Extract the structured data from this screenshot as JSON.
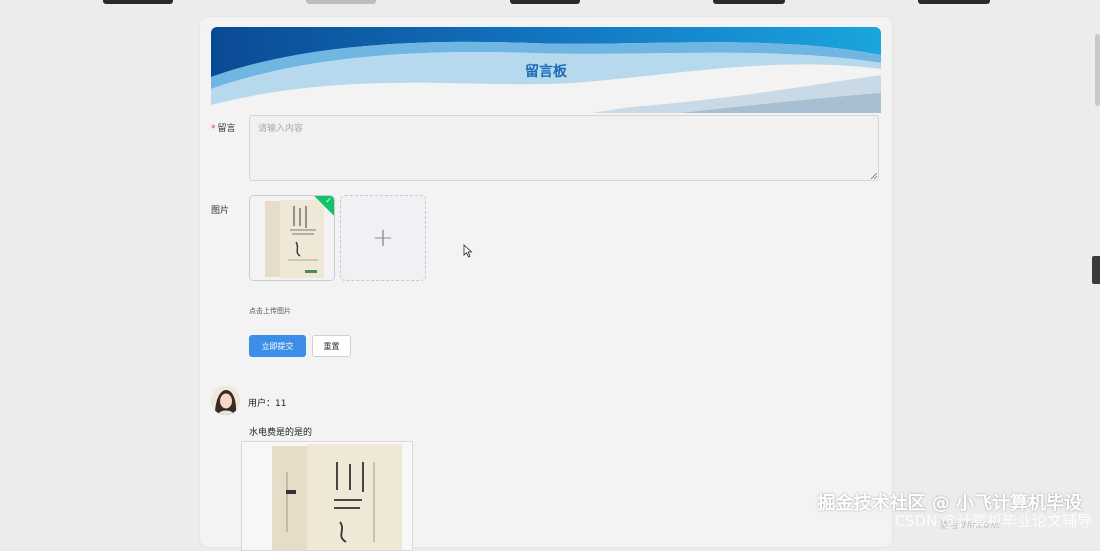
{
  "banner": {
    "title": "留言板"
  },
  "form": {
    "message_label": "留言",
    "message_required_mark": "*",
    "message_placeholder": "请输入内容",
    "image_label": "图片",
    "upload_hint": "点击上传图片",
    "submit_label": "立即提交",
    "reset_label": "重置",
    "upload_plus": "+"
  },
  "comments": [
    {
      "user_label": "用户：11",
      "text": "水电费是的是的"
    }
  ],
  "watermark": {
    "line1": "掘金技术社区 @ 小飞计算机毕设",
    "line2": "CSDN @计算机毕业论文辅导"
  },
  "system": {
    "activate_windows": "激活 Windows"
  },
  "colors": {
    "primary": "#3d8ee8",
    "banner_title": "#1b6cb5",
    "upload_success": "#13c16b",
    "required": "#e53935"
  },
  "icons": {
    "upload": "plus-icon",
    "success": "check-icon",
    "cursor": "mouse-pointer-icon"
  }
}
